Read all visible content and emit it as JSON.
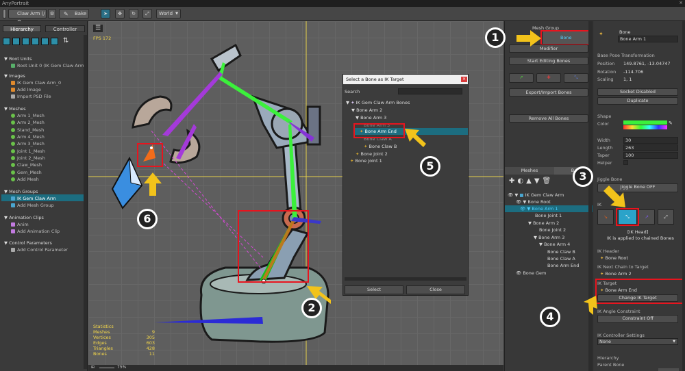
{
  "window": {
    "title": "AnyPortrait",
    "close": "×"
  },
  "toolbar": {
    "target": "Claw Arm (/ ⚙",
    "bake": "Bake",
    "space": "World"
  },
  "left": {
    "tabs": [
      "Hierarchy",
      "Controller"
    ],
    "root_units": {
      "header": "Root Units",
      "items": [
        "Root Unit 0 (IK Gem Claw Arm)"
      ]
    },
    "images": {
      "header": "Images",
      "items": [
        "IK Gem Claw Arm_0",
        "Add Image",
        "Import PSD File"
      ]
    },
    "meshes": {
      "header": "Meshes",
      "items": [
        "Arm 1_Mesh",
        "Arm 2_Mesh",
        "Stand_Mesh",
        "Arm 4_Mesh",
        "Arm 3_Mesh",
        "Joint 1_Mesh",
        "Joint 2_Mesh",
        "Claw_Mesh",
        "Gem_Mesh",
        "Add Mesh"
      ]
    },
    "mesh_groups": {
      "header": "Mesh Groups",
      "items": [
        "IK Gem Claw Arm",
        "Add Mesh Group"
      ]
    },
    "anim": {
      "header": "Animation Clips",
      "items": [
        "Anim",
        "Add Animation Clip"
      ]
    },
    "params": {
      "header": "Control Parameters",
      "items": [
        "Add Control Parameter"
      ]
    }
  },
  "canvas": {
    "fps": "FPS 172",
    "stats": {
      "title": "Statistics",
      "rows": [
        [
          "Meshes",
          "9"
        ],
        [
          "Vertices",
          "305"
        ],
        [
          "Edges",
          "603"
        ],
        [
          "Triangles",
          "428"
        ],
        [
          "Bones",
          "11"
        ]
      ]
    },
    "zoom": "75%"
  },
  "dialog": {
    "title": "Select a Bone as IK Target",
    "search": "Search",
    "tree": [
      "IK Gem Claw Arm Bones",
      "Bone Arm 2",
      "Bone Arm 3",
      "Bone Arm 3",
      "Bone Arm End",
      "Bone Claw A",
      "Bone Claw B",
      "Bone Joint 2",
      "Bone Joint 1"
    ],
    "select": "Select",
    "close": "Close"
  },
  "mid": {
    "header": "Mesh Group",
    "bone_tab": "Bone",
    "modifier": "Modifier",
    "start_editing": "Start Editing Bones",
    "export_import": "Export/Import Bones",
    "remove_all": "Remove All Bones",
    "tabs": [
      "Meshes",
      "B"
    ],
    "tree": [
      "IK Gem Claw Arm",
      "Bone Root",
      "Bone Arm 1",
      "Bone Joint 1",
      "Bone Arm 2",
      "Bone Joint 2",
      "Bone Arm 3",
      "Bone Arm 4",
      "Bone Claw B",
      "Bone Claw A",
      "Bone Arm End",
      "Bone Gem"
    ]
  },
  "right": {
    "bone_label": "Bone",
    "bone_name": "Bone Arm 1",
    "base_pose": "Base Pose Transformation",
    "position": [
      "Position",
      "149.8761, -13.04747"
    ],
    "rotation": [
      "Rotation",
      "-114.706"
    ],
    "scaling": [
      "Scaling",
      "1, 1"
    ],
    "socket": "Socket Disabled",
    "duplicate": "Duplicate",
    "shape": "Shape",
    "color": "Color",
    "width": [
      "Width",
      "30"
    ],
    "length": [
      "Length",
      "263"
    ],
    "taper": [
      "Taper",
      "100"
    ],
    "helper": "Helper",
    "jiggle": "Jiggle Bone",
    "jiggle_btn": "Jiggle Bone OFF",
    "ik": "IK",
    "ik_head": "[IK Head]",
    "ik_head_desc": "IK is applied to chained Bones",
    "ik_header": "IK Header",
    "ik_header_val": "Bone Root",
    "ik_next": "IK Next Chain to Target",
    "ik_next_val": "Bone Arm 2",
    "ik_target": "IK Target",
    "ik_target_val": "Bone Arm End",
    "change_ik": "Change IK Target",
    "ik_angle": "IK Angle Constraint",
    "constraint": "Constraint Off",
    "ik_ctrl": "IK Controller Settings",
    "ik_ctrl_val": "None",
    "hierarchy": "Hierarchy",
    "parent": "Parent Bone"
  },
  "callouts": [
    "1",
    "2",
    "3",
    "4",
    "5",
    "6"
  ],
  "colors": {
    "accent": "#2ba3c9",
    "red": "#e8141e",
    "arrow": "#f2c31b",
    "selected": "#1c6d80"
  }
}
